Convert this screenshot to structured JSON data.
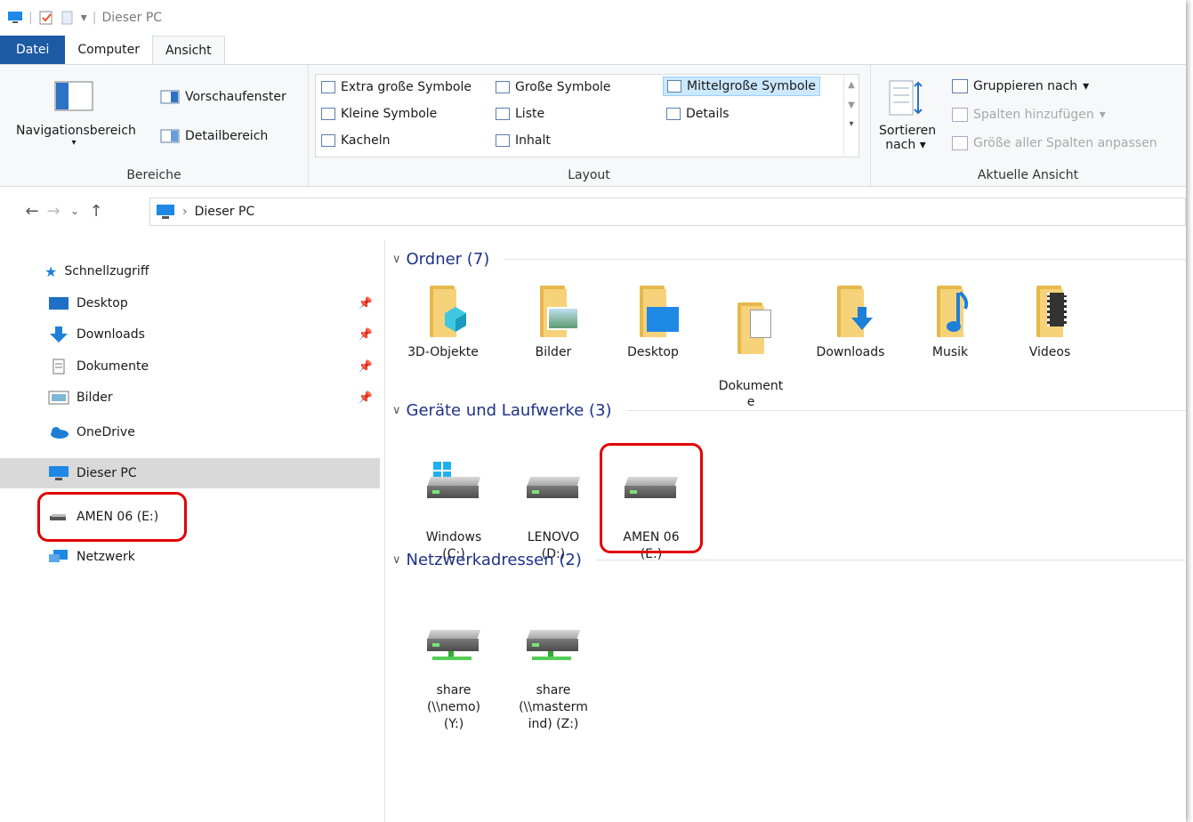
{
  "titlebar": {
    "title": "Dieser PC"
  },
  "tabs": [
    {
      "label": "Datei"
    },
    {
      "label": "Computer"
    },
    {
      "label": "Ansicht"
    }
  ],
  "ribbon": {
    "bereiche": {
      "nav_pane": "Navigationsbereich",
      "preview": "Vorschaufenster",
      "details": "Detailbereich",
      "group": "Bereiche"
    },
    "layout": {
      "extra_large": "Extra große Symbole",
      "large": "Große Symbole",
      "medium": "Mittelgroße Symbole",
      "small": "Kleine Symbole",
      "list": "Liste",
      "details": "Details",
      "tiles": "Kacheln",
      "content": "Inhalt",
      "group": "Layout"
    },
    "current_view": {
      "sort": "Sortieren",
      "sort2": "nach",
      "group_by": "Gruppieren nach",
      "add_columns": "Spalten hinzufügen",
      "fit_columns": "Größe aller Spalten anpassen",
      "group": "Aktuelle Ansicht"
    }
  },
  "address": {
    "path": "Dieser PC"
  },
  "sidebar": {
    "items": [
      {
        "label": "Schnellzugriff"
      },
      {
        "label": "Desktop"
      },
      {
        "label": "Downloads"
      },
      {
        "label": "Dokumente"
      },
      {
        "label": "Bilder"
      },
      {
        "label": "OneDrive"
      },
      {
        "label": "Dieser PC"
      },
      {
        "label": "AMEN 06 (E:)"
      },
      {
        "label": "Netzwerk"
      }
    ]
  },
  "content": {
    "folders_header": "Ordner (7)",
    "folders": [
      {
        "label": "3D-Objekte"
      },
      {
        "label": "Bilder"
      },
      {
        "label": "Desktop"
      },
      {
        "label": "Dokument\ne"
      },
      {
        "label": "Downloads"
      },
      {
        "label": "Musik"
      },
      {
        "label": "Videos"
      }
    ],
    "drives_header": "Geräte und Laufwerke (3)",
    "drives": [
      {
        "label": "Windows\n(C:)"
      },
      {
        "label": "LENOVO\n(D:)"
      },
      {
        "label": "AMEN 06\n(E:)"
      }
    ],
    "network_header": "Netzwerkadressen (2)",
    "network": [
      {
        "label": "share\n(\\\\nemo)\n(Y:)"
      },
      {
        "label": "share\n(\\\\masterm\nind) (Z:)"
      }
    ]
  },
  "colors": {
    "accent": "#1c5aa3",
    "highlight": "#e00000",
    "section_header": "#1e3287"
  }
}
